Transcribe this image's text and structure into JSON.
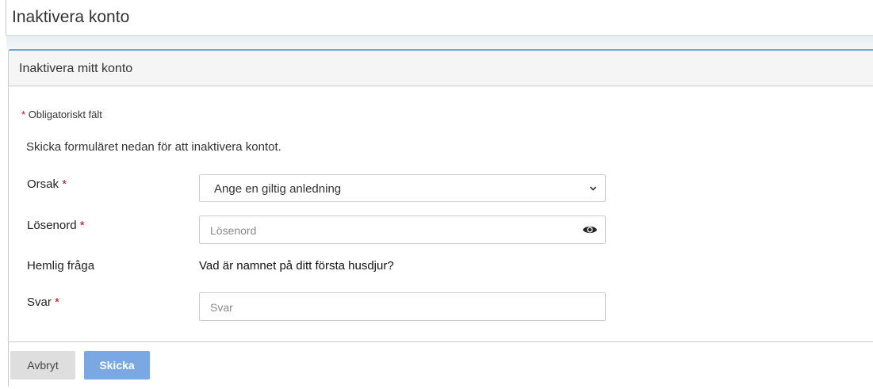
{
  "page": {
    "title": "Inaktivera konto"
  },
  "panel": {
    "title": "Inaktivera mitt konto",
    "required_marker": "*",
    "required_note": "Obligatoriskt fält",
    "intro": "Skicka formuläret nedan för att inaktivera kontot."
  },
  "form": {
    "reason": {
      "label": "Orsak",
      "selected": "Ange en giltig anledning"
    },
    "password": {
      "label": "Lösenord",
      "placeholder": "Lösenord"
    },
    "secret_question": {
      "label": "Hemlig fråga",
      "value": "Vad är namnet på ditt första husdjur?"
    },
    "answer": {
      "label": "Svar",
      "placeholder": "Svar"
    }
  },
  "buttons": {
    "cancel": "Avbryt",
    "submit": "Skicka"
  },
  "icons": {
    "select": "chevron-down-icon",
    "password_toggle": "eye-icon"
  },
  "colors": {
    "accent": "#7ba8e3",
    "panel_border_top": "#6ea3dd",
    "required": "#d0021b"
  }
}
